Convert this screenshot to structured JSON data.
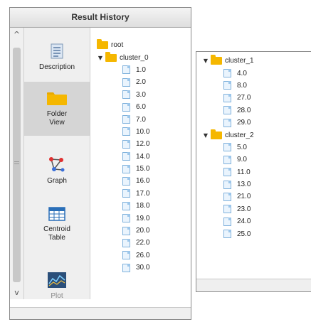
{
  "left_panel": {
    "title": "Result History",
    "nav": [
      {
        "label": "Description",
        "icon": "description-icon"
      },
      {
        "label": "Folder View",
        "icon": "folder-icon"
      },
      {
        "label": "Graph",
        "icon": "graph-icon"
      },
      {
        "label": "Centroid Table",
        "icon": "table-icon"
      },
      {
        "label": "Plot",
        "icon": "plot-icon"
      }
    ],
    "tree": {
      "root": "root",
      "cluster_0": {
        "label": "cluster_0",
        "files": [
          "1.0",
          "2.0",
          "3.0",
          "6.0",
          "7.0",
          "10.0",
          "12.0",
          "14.0",
          "15.0",
          "16.0",
          "17.0",
          "18.0",
          "19.0",
          "20.0",
          "22.0",
          "26.0",
          "30.0"
        ]
      }
    }
  },
  "right_panel": {
    "cluster_1": {
      "label": "cluster_1",
      "files": [
        "4.0",
        "8.0",
        "27.0",
        "28.0",
        "29.0"
      ]
    },
    "cluster_2": {
      "label": "cluster_2",
      "files": [
        "5.0",
        "9.0",
        "11.0",
        "13.0",
        "21.0",
        "23.0",
        "24.0",
        "25.0"
      ]
    }
  },
  "colors": {
    "folder": "#f5b700",
    "active_nav": "#d5d5d5",
    "file_border": "#7fb1dc"
  }
}
